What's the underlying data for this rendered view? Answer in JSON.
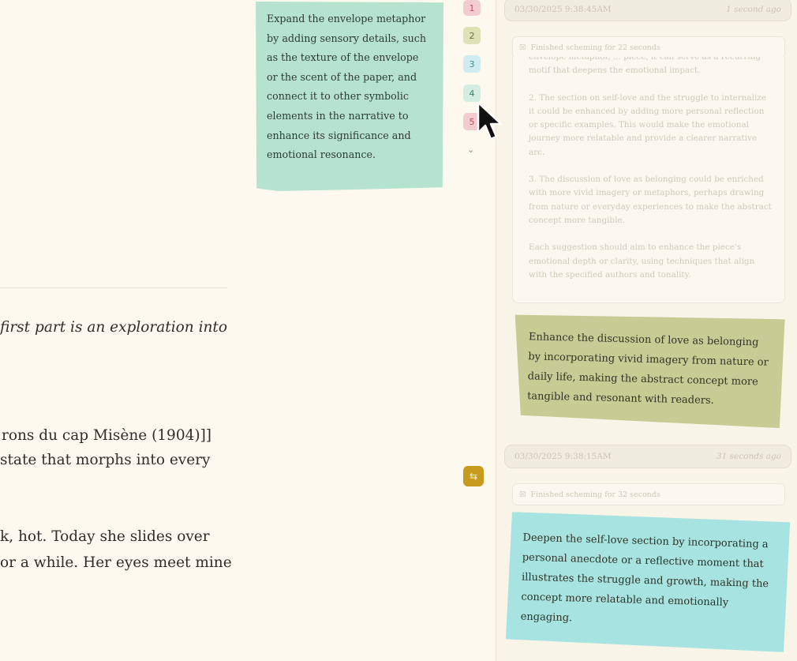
{
  "editor": {
    "lines": [
      "first part is an exploration into",
      "rons du cap Misène (1904)]]",
      " state that morphs into every",
      "k, hot. Today she slides over",
      "or a while. Her eyes meet mine"
    ]
  },
  "note_green": {
    "text": "Expand the envelope metaphor by adding sensory details, such as the texture of the envelope or the scent of the paper, and connect it to other symbolic elements in the narrative to enhance its significance and emotional resonance."
  },
  "markers": [
    "1",
    "2",
    "3",
    "4",
    "5"
  ],
  "chevron": "⌄",
  "control_icon": "⇆",
  "panel": {
    "entry1": {
      "timestamp": "03/30/2025 9:38:45AM",
      "ago": "1 second ago",
      "scheme_label": "Finished scheming for 22 seconds",
      "reasoning": [
        "envelope metaphor, ... piece, it can serve as a recurring motif that deepens the emotional impact.",
        "2. The section on self-love and the struggle to internalize it could be enhanced by adding more personal reflection or specific examples. This would make the emotional journey more relatable and provide a clearer narrative arc.",
        "3. The discussion of love as belonging could be enriched with more vivid imagery or metaphors, perhaps drawing from nature or everyday experiences to make the abstract concept more tangible.",
        "Each suggestion should aim to enhance the piece's emotional depth or clarity, using techniques that align with the specified authors and tonality."
      ],
      "note": "Enhance the discussion of love as belonging by incorporating vivid imagery from nature or daily life, making the abstract concept more tangible and resonant with readers."
    },
    "entry2": {
      "timestamp": "03/30/2025 9:38:15AM",
      "ago": "31 seconds ago",
      "scheme_label": "Finished scheming for 32 seconds",
      "note": "Deepen the self-love section by incorporating a personal anecdote or a reflective moment that illustrates the struggle and growth, making the concept more relatable and emotionally engaging."
    }
  },
  "colors": {
    "background": "#fdf9ee",
    "note_green": "#b6e3d0",
    "note_olive": "#c6cc94",
    "note_cyan": "#a6e3e1",
    "control_icon": "#c89b1f"
  }
}
